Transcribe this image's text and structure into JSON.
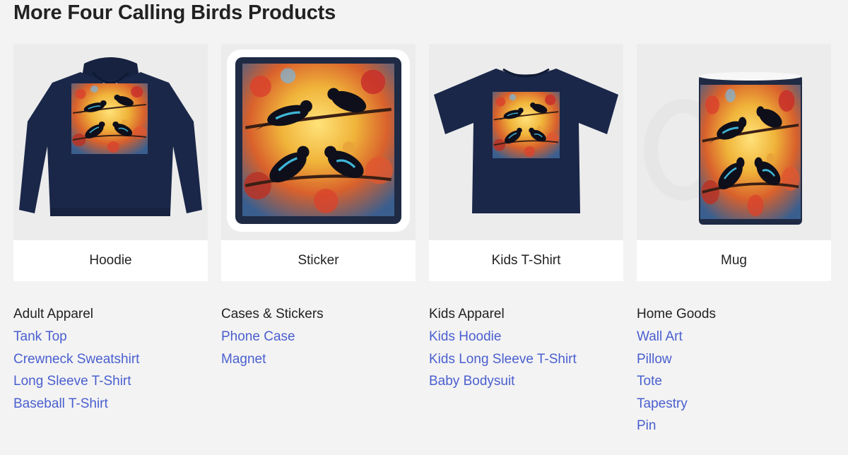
{
  "title": "More Four Calling Birds Products",
  "products": [
    {
      "label": "Hoodie",
      "icon": "hoodie-icon"
    },
    {
      "label": "Sticker",
      "icon": "sticker-icon"
    },
    {
      "label": "Kids T-Shirt",
      "icon": "kids-tshirt-icon"
    },
    {
      "label": "Mug",
      "icon": "mug-icon"
    }
  ],
  "categories": [
    {
      "heading": "Adult Apparel",
      "links": [
        "Tank Top",
        "Crewneck Sweatshirt",
        "Long Sleeve T-Shirt",
        "Baseball T-Shirt"
      ]
    },
    {
      "heading": "Cases & Stickers",
      "links": [
        "Phone Case",
        "Magnet"
      ]
    },
    {
      "heading": "Kids Apparel",
      "links": [
        "Kids Hoodie",
        "Kids Long Sleeve T-Shirt",
        "Baby Bodysuit"
      ]
    },
    {
      "heading": "Home Goods",
      "links": [
        "Wall Art",
        "Pillow",
        "Tote",
        "Tapestry",
        "Pin"
      ]
    }
  ],
  "colors": {
    "background": "#f3f3f3",
    "link": "#4a5fcf",
    "navy": "#1a2749",
    "artwork_sky": "#f0b43a",
    "artwork_leaves": "#d9432c",
    "artwork_bird": "#0e0f1a",
    "artwork_bird_accent": "#3fb6d8"
  }
}
